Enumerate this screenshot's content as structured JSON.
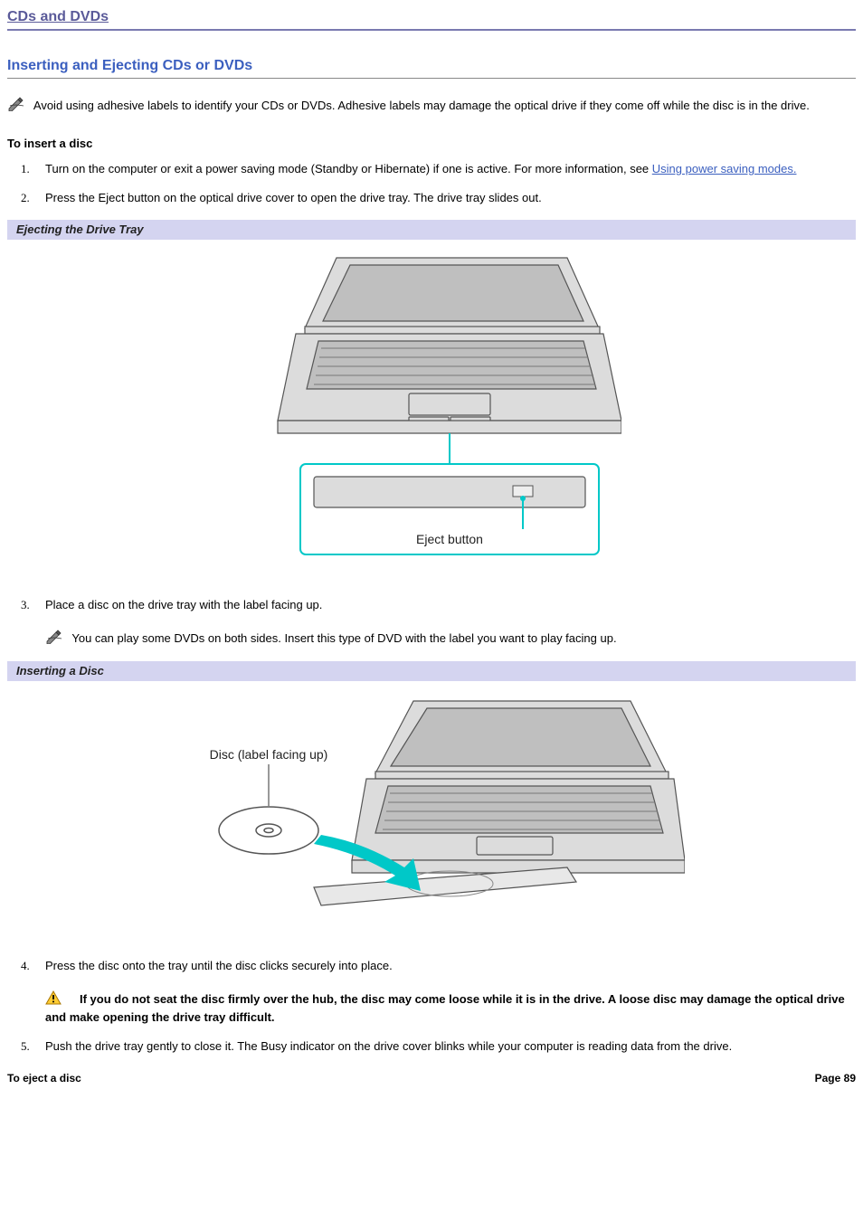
{
  "page_title": "CDs and DVDs",
  "section_title": "Inserting and Ejecting CDs or DVDs",
  "intro_note": " Avoid using adhesive labels to identify your CDs or DVDs. Adhesive labels may damage the optical drive if they come off while the disc is in the drive.",
  "insert_heading": "To insert a disc",
  "steps": {
    "s1_pre": "Turn on the computer or exit a power saving mode (Standby or Hibernate) if one is active. For more information, see ",
    "s1_link": "Using power saving modes.",
    "s2": "Press the Eject button on the optical drive cover to open the drive tray. The drive tray slides out.",
    "s3": "Place a disc on the drive tray with the label facing up.",
    "s3_note": " You can play some DVDs on both sides. Insert this type of DVD with the label you want to play facing up.",
    "s4": "Press the disc onto the tray until the disc clicks securely into place.",
    "s4_warning": "If you do not seat the disc firmly over the hub, the disc may come loose while it is in the drive. A loose disc may damage the optical drive and make opening the drive tray difficult.",
    "s5": "Push the drive tray gently to close it. The Busy indicator on the drive cover blinks while your computer is reading data from the drive."
  },
  "figure1": {
    "caption": "Ejecting the Drive Tray",
    "callout": "Eject button"
  },
  "figure2": {
    "caption": "Inserting a Disc",
    "callout": "Disc (label facing up)"
  },
  "eject_heading": "To eject a disc",
  "page_number": "Page 89"
}
